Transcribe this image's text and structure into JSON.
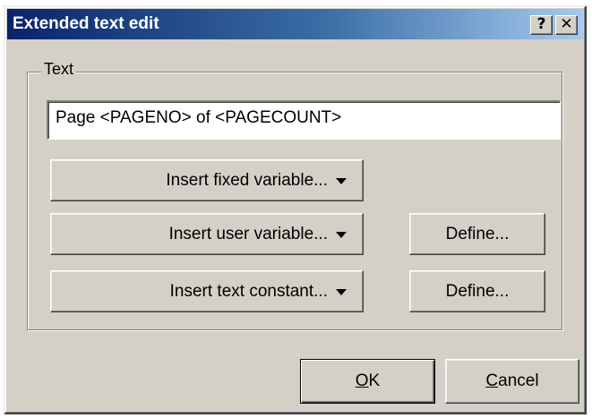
{
  "window": {
    "title": "Extended text edit",
    "help_button": "?",
    "close_button": "✕"
  },
  "group": {
    "legend": "Text"
  },
  "text_field": {
    "value": "Page <PAGENO> of <PAGECOUNT>"
  },
  "buttons": {
    "insert_fixed": "Insert fixed variable...",
    "insert_user": "Insert user variable...",
    "insert_constant": "Insert text constant...",
    "define_user": "Define...",
    "define_constant": "Define...",
    "ok_mnemonic": "O",
    "ok_rest": "K",
    "cancel_mnemonic": "C",
    "cancel_rest": "ancel"
  },
  "colors": {
    "titlebar_start": "#0a246a",
    "titlebar_end": "#a6caf0",
    "dialog_face": "#d4d0c8"
  }
}
